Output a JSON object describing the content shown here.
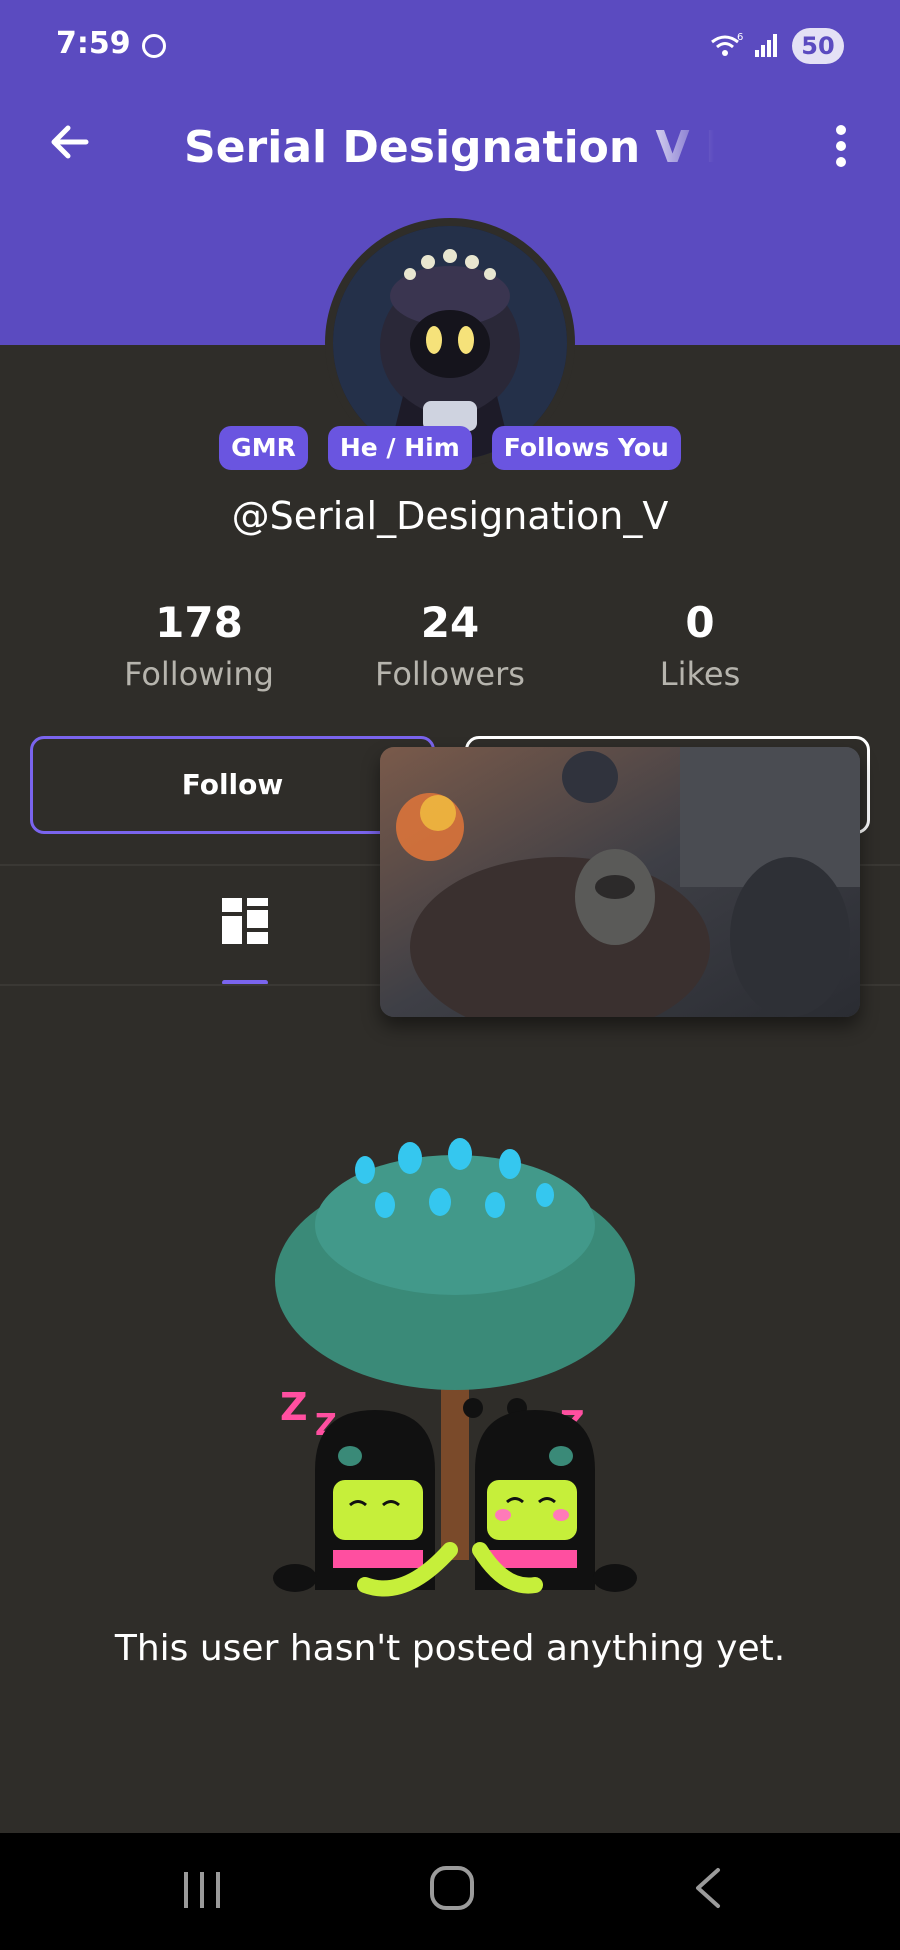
{
  "status_bar": {
    "time": "7:59",
    "battery": "50",
    "wifi_label": "6"
  },
  "header": {
    "title": "Serial Designation V Is I",
    "back_icon": "arrow-left-icon",
    "more_icon": "more-vertical-icon",
    "background_color": "#5b4bc0"
  },
  "profile": {
    "badges": [
      "GMR",
      "He / Him",
      "Follows You"
    ],
    "handle": "@Serial_Designation_V",
    "stats": [
      {
        "value": "178",
        "label": "Following"
      },
      {
        "value": "24",
        "label": "Followers"
      },
      {
        "value": "0",
        "label": "Likes"
      }
    ],
    "follow_label": "Follow"
  },
  "tabs": {
    "active_icon": "grid-icon",
    "accent_color": "#7a64ee"
  },
  "empty_state": {
    "message": "This user hasn't posted anything yet."
  },
  "nav_bar": {
    "icons": [
      "recent-apps-icon",
      "home-icon",
      "back-icon"
    ]
  }
}
